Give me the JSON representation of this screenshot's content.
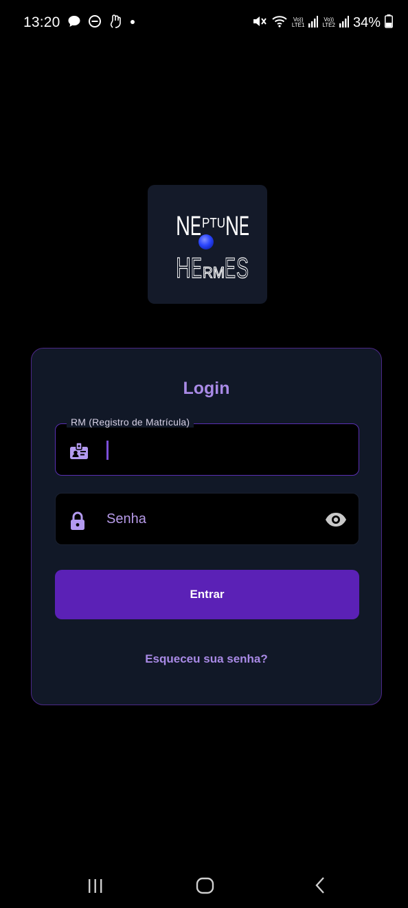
{
  "status_bar": {
    "time": "13:20",
    "battery": "34%",
    "sim1_top": "Vo))",
    "sim1_bottom": "LTE1",
    "sim2_top": "Vo))",
    "sim2_bottom": "LTE2"
  },
  "logo": {
    "line1": "NEPTUNE",
    "line2": "HERMES"
  },
  "login": {
    "title": "Login",
    "rm_label": "RM (Registro de Matrícula)",
    "rm_value": "",
    "password_placeholder": "Senha",
    "submit_label": "Entrar",
    "forgot_label": "Esqueceu sua senha?"
  },
  "colors": {
    "accent": "#a98ae6",
    "button": "#5b21b6",
    "card": "#111827",
    "card_border": "#4c2889"
  },
  "icons": [
    "message-icon",
    "do-not-disturb-icon",
    "gesture-icon",
    "mute-icon",
    "wifi-icon",
    "signal-icon",
    "battery-icon",
    "badge-icon",
    "lock-icon",
    "eye-icon",
    "recent-apps-icon",
    "home-icon",
    "back-icon"
  ]
}
